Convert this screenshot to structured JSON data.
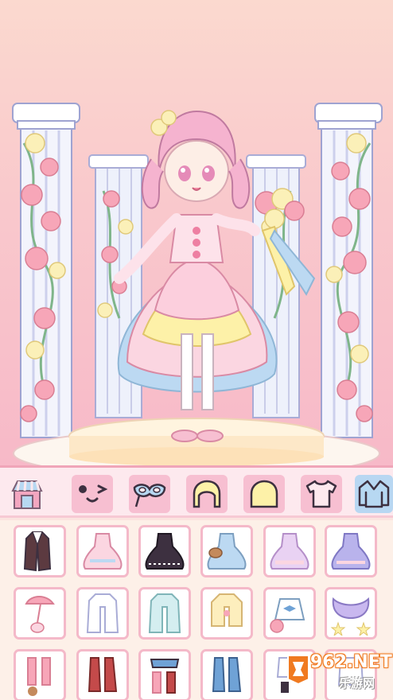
{
  "colors": {
    "accent_pink": "#f7bfd1",
    "active_tab": "#b8d7f2",
    "card_border": "#f4b9c9",
    "panel_bg": "#fdf0e8"
  },
  "categories": [
    {
      "icon": "shop-icon",
      "active": false
    },
    {
      "icon": "face-expression-icon",
      "active": false
    },
    {
      "icon": "mask-accessory-icon",
      "active": false
    },
    {
      "icon": "front-hair-icon",
      "active": false
    },
    {
      "icon": "back-hair-icon",
      "active": false
    },
    {
      "icon": "tshirt-icon",
      "active": false
    },
    {
      "icon": "jacket-icon",
      "active": true
    }
  ],
  "items": [
    "dark-coat-icon",
    "pink-dress-icon",
    "black-gothic-dress-icon",
    "blue-dress-icon",
    "lavender-dress-icon",
    "purple-dress-icon",
    "pink-umbrella-icon",
    "white-coat-icon",
    "mint-coat-icon",
    "cream-jacket-icon",
    "blue-bow-top-icon",
    "star-cape-icon",
    "pink-sleeves-icon",
    "red-jacket-icon",
    "hoodie-icon",
    "blue-jacket-icon",
    "lantern-outfit-icon",
    "white-outfit-icon"
  ],
  "watermark": {
    "brand": "962.NET",
    "sub": "乐游网"
  }
}
